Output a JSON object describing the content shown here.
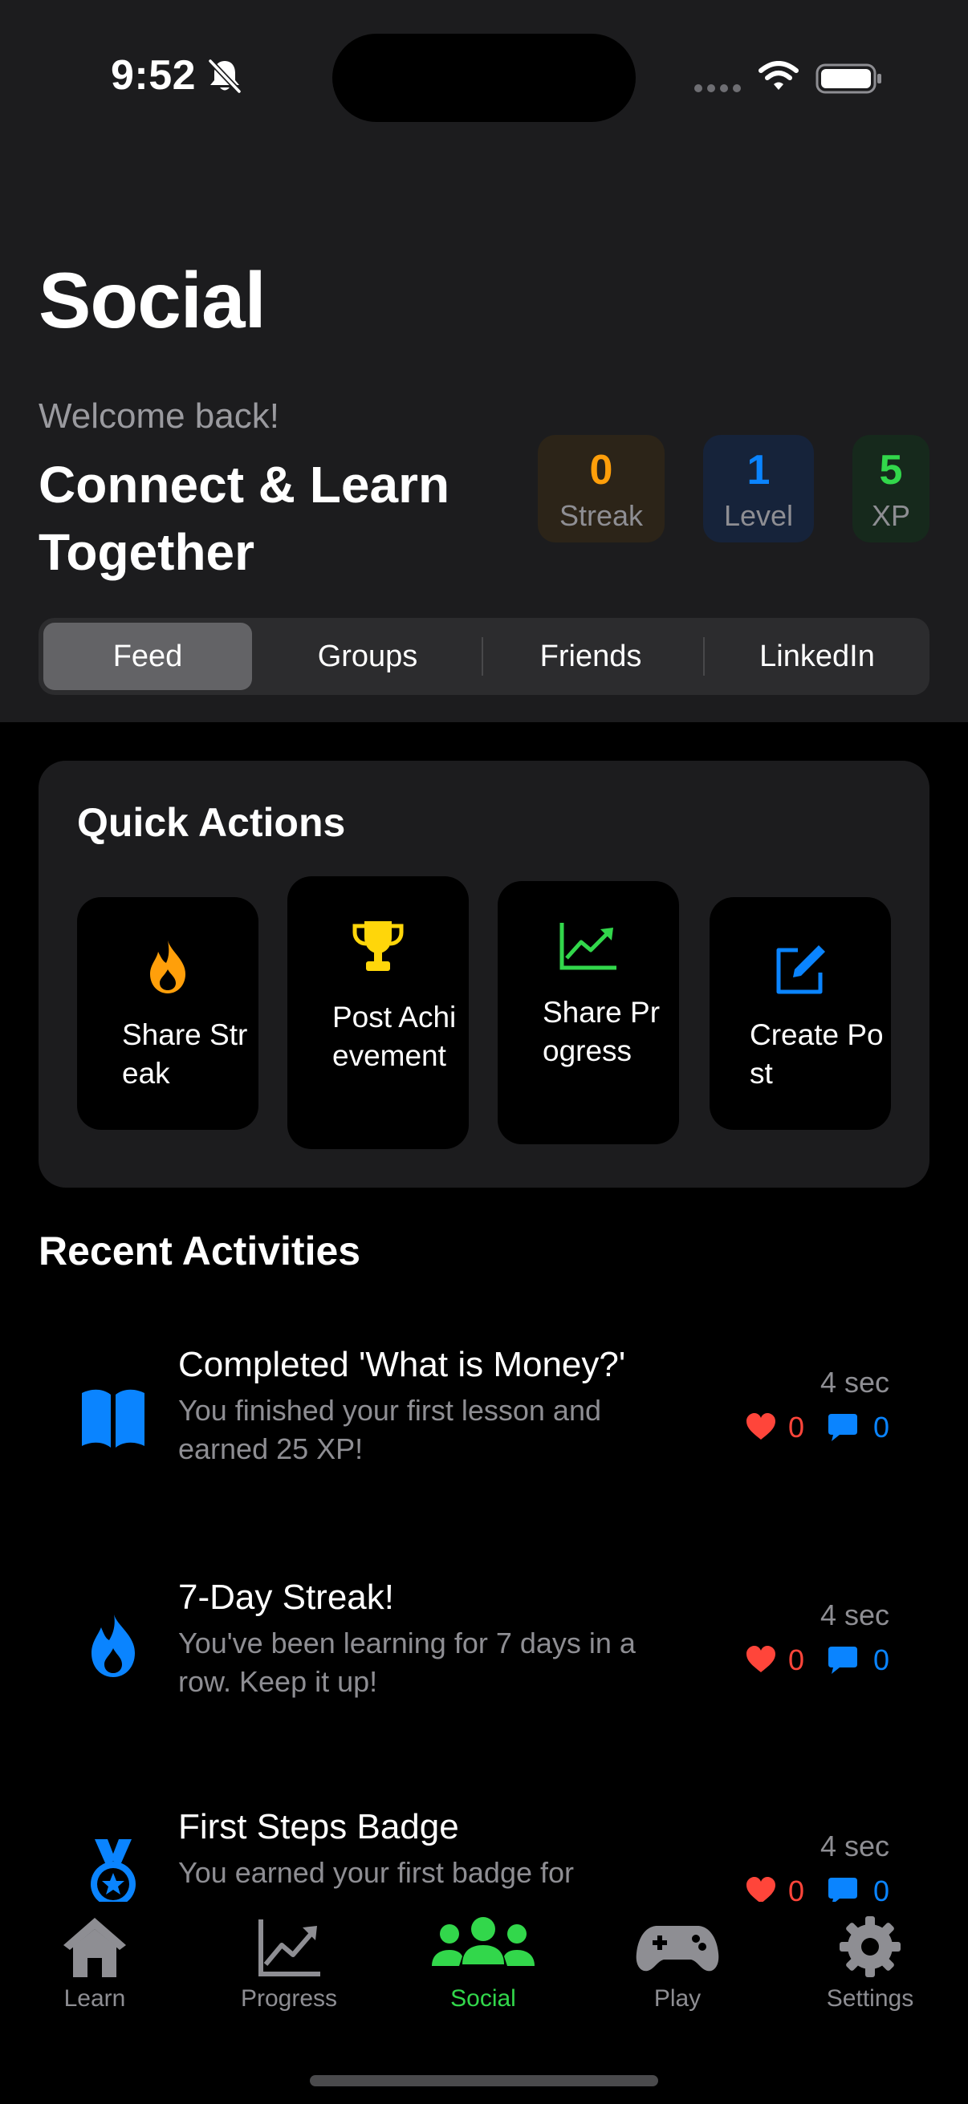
{
  "status_bar": {
    "time": "9:52"
  },
  "page": {
    "title": "Social"
  },
  "hero": {
    "welcome": "Welcome back!",
    "tagline": "Connect & Learn Together"
  },
  "stats": {
    "streak": {
      "value": "0",
      "label": "Streak",
      "color": "#ff9f0a"
    },
    "level": {
      "value": "1",
      "label": "Level",
      "color": "#0a84ff"
    },
    "xp": {
      "value": "5",
      "label": "XP",
      "color": "#32d74b"
    }
  },
  "segments": [
    "Feed",
    "Groups",
    "Friends",
    "LinkedIn"
  ],
  "active_segment": "Feed",
  "quick_actions": {
    "title": "Quick Actions",
    "items": [
      {
        "label": "Share Streak",
        "icon": "flame-icon",
        "color": "#ff9f0a"
      },
      {
        "label": "Post Achievement",
        "icon": "trophy-icon",
        "color": "#ffd60a"
      },
      {
        "label": "Share Progress",
        "icon": "chart-up-icon",
        "color": "#32d74b"
      },
      {
        "label": "Create Post",
        "icon": "compose-icon",
        "color": "#0a84ff"
      }
    ]
  },
  "recent": {
    "title": "Recent Activities",
    "items": [
      {
        "title": "Completed 'What is Money?'",
        "description": "You finished your first lesson and earned 25 XP!",
        "time": "4 sec",
        "likes": "0",
        "comments": "0",
        "icon": "book-icon"
      },
      {
        "title": "7-Day Streak!",
        "description": "You've been learning for 7 days in a row. Keep it up!",
        "time": "4 sec",
        "likes": "0",
        "comments": "0",
        "icon": "flame-icon"
      },
      {
        "title": "First Steps Badge",
        "description": "You earned your first badge for",
        "time": "4 sec",
        "likes": "0",
        "comments": "0",
        "icon": "medal-icon"
      }
    ]
  },
  "tabbar": {
    "items": [
      {
        "label": "Learn",
        "icon": "house-icon"
      },
      {
        "label": "Progress",
        "icon": "chart-icon"
      },
      {
        "label": "Social",
        "icon": "people-icon"
      },
      {
        "label": "Play",
        "icon": "gamepad-icon"
      },
      {
        "label": "Settings",
        "icon": "gear-icon"
      }
    ],
    "active": "Social",
    "active_color": "#32d74b"
  }
}
